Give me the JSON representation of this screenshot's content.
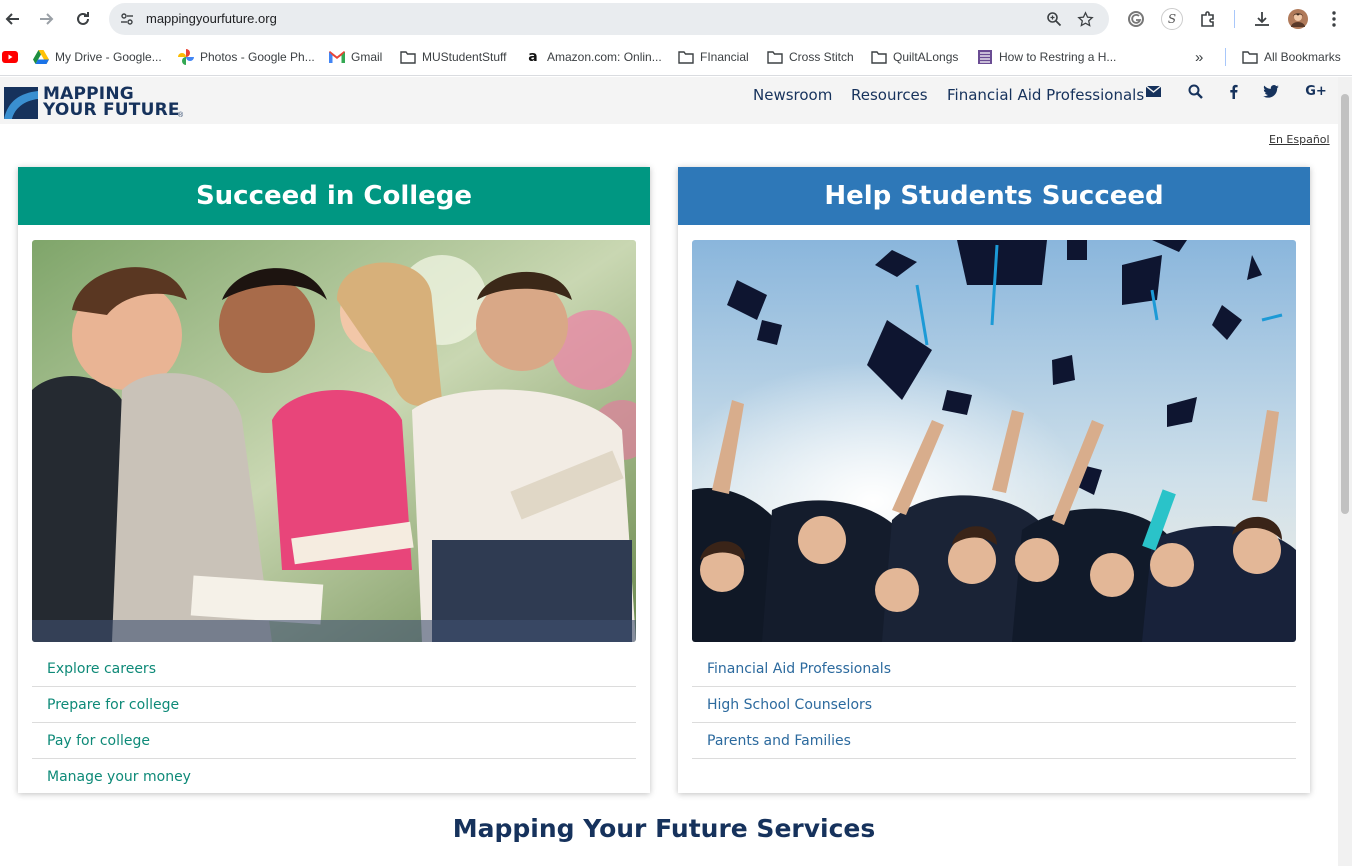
{
  "browser": {
    "url": "mappingyourfuture.org",
    "bookmarks": [
      {
        "label": "",
        "icon": "youtube-icon"
      },
      {
        "label": "My Drive - Google...",
        "icon": "google-drive-icon"
      },
      {
        "label": "Photos - Google Ph...",
        "icon": "google-photos-icon"
      },
      {
        "label": "Gmail",
        "icon": "gmail-icon"
      },
      {
        "label": "MUStudentStuff",
        "icon": "folder-icon"
      },
      {
        "label": "Amazon.com: Onlin...",
        "icon": "amazon-icon"
      },
      {
        "label": "FInancial",
        "icon": "folder-icon"
      },
      {
        "label": "Cross Stitch",
        "icon": "folder-icon"
      },
      {
        "label": "QuiltALongs",
        "icon": "folder-icon"
      },
      {
        "label": "How to Restring a H...",
        "icon": "page-icon"
      }
    ],
    "more_label": "»",
    "all_bookmarks": "All Bookmarks"
  },
  "site": {
    "logo": {
      "line1": "MAPPING",
      "line2": "YOUR FUTURE",
      "mark": "®"
    },
    "nav": [
      "Newsroom",
      "Resources",
      "Financial Aid Professionals"
    ],
    "social_icons": [
      "envelope-icon",
      "search-icon",
      "facebook-icon",
      "twitter-icon",
      "google-plus-icon"
    ],
    "social_text": {
      "gplus": "G+"
    },
    "language_link": "En Español"
  },
  "cards": [
    {
      "title": "Succeed in College",
      "header_color": "#009782",
      "link_color": "#0e8a78",
      "image": "students studying outdoors",
      "links": [
        "Explore careers",
        "Prepare for college",
        "Pay for college",
        "Manage your money"
      ]
    },
    {
      "title": "Help Students Succeed",
      "header_color": "#2e78b8",
      "link_color": "#2c6a9e",
      "image": "graduates throwing caps",
      "links": [
        "Financial Aid Professionals",
        "High School Counselors",
        "Parents and Families"
      ]
    }
  ],
  "services_title": "Mapping Your Future Services",
  "colors": {
    "brand_navy": "#16325c",
    "teal": "#009782",
    "blue": "#2e78b8"
  }
}
